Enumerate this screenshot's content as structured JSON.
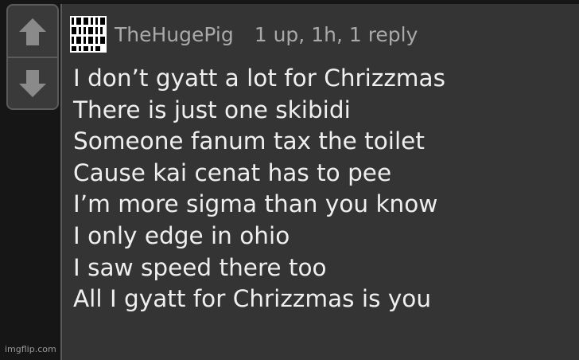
{
  "comment": {
    "username": "TheHugePig",
    "meta": "1 up, 1h, 1 reply",
    "avatar_name": "binary-pattern-avatar",
    "lines": [
      "I don’t gyatt a lot for Chrizzmas",
      "There is just one skibidi",
      "Someone fanum tax the toilet",
      "Cause kai cenat has to pee",
      "I’m more sigma than you know",
      "I only edge in ohio",
      "I saw speed there too",
      "All I gyatt for Chrizzmas is you"
    ]
  },
  "vote": {
    "up_icon": "arrow-up-icon",
    "down_icon": "arrow-down-icon"
  },
  "watermark": "imgflip.com",
  "colors": {
    "background": "#161616",
    "panel": "#343434",
    "text": "#efefef",
    "meta_text": "#a9a9a9"
  }
}
